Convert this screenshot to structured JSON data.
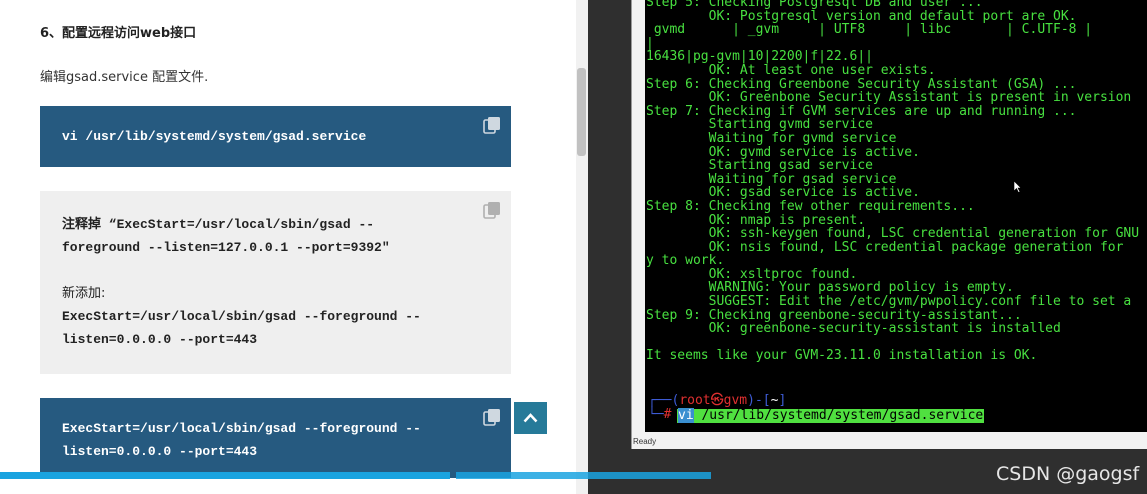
{
  "article": {
    "heading": "6、配置远程访问web接口",
    "intro": "编辑gsad.service 配置文件.",
    "code1": "vi /usr/lib/systemd/system/gsad.service",
    "code2": {
      "line1": "注释掉 “ExecStart=/usr/local/sbin/gsad --",
      "line2": "foreground --listen=127.0.0.1 --port=9392\"",
      "line3": "新添加:",
      "line4": "ExecStart=/usr/local/sbin/gsad --foreground --",
      "line5": "listen=0.0.0.0 --port=443"
    },
    "code3": {
      "line1": "ExecStart=/usr/local/sbin/gsad --foreground --",
      "line2": "listen=0.0.0.0 --port=443"
    },
    "icons": {
      "copy": "copy-icon",
      "scroll_top": "chevron-up-icon"
    }
  },
  "terminal": {
    "lines": [
      "Step 5: Checking Postgresql DB and user ...",
      "        OK: Postgresql version and default port are OK.",
      " gvmd      | _gvm     | UTF8     | libc       | C.UTF-8 |",
      "|",
      "16436|pg-gvm|10|2200|f|22.6||",
      "        OK: At least one user exists.",
      "Step 6: Checking Greenbone Security Assistant (GSA) ...",
      "        OK: Greenbone Security Assistant is present in version",
      "Step 7: Checking if GVM services are up and running ...",
      "        Starting gvmd service",
      "        Waiting for gvmd service",
      "        OK: gvmd service is active.",
      "        Starting gsad service",
      "        Waiting for gsad service",
      "        OK: gsad service is active.",
      "Step 8: Checking few other requirements...",
      "        OK: nmap is present.",
      "        OK: ssh-keygen found, LSC credential generation for GNU",
      "        OK: nsis found, LSC credential package generation for",
      "y to work.",
      "        OK: xsltproc found.",
      "        WARNING: Your password policy is empty.",
      "        SUGGEST: Edit the /etc/gvm/pwpolicy.conf file to set a",
      "Step 9: Checking greenbone-security-assistant...",
      "        OK: greenbone-security-assistant is installed",
      "",
      "It seems like your GVM-23.11.0 installation is OK."
    ],
    "prompt": {
      "open": "┌──(",
      "user": "root",
      "at": "㉿",
      "host": "gvm",
      "close": ")-[",
      "dir": "~",
      "end": "]",
      "second": "└─",
      "hash": "#"
    },
    "command_vi": "vi",
    "command_rest": " /usr/lib/systemd/system/gsad.service",
    "status": "Ready"
  },
  "progress": {
    "played_fraction": 0.392,
    "buffered_fraction": 0.62
  },
  "watermark": "CSDN @gaogsf",
  "colors": {
    "code_dark": "#265a80",
    "code_light": "#efefef",
    "terminal_text": "#48e040",
    "progress": "#1aa3e0",
    "scroll_top": "#267a99"
  }
}
